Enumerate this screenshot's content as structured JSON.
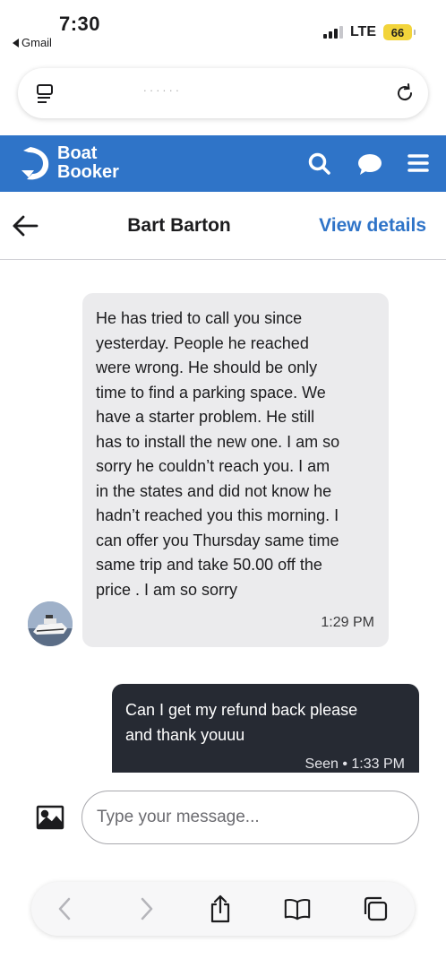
{
  "status_bar": {
    "time": "7:30",
    "back_app": "Gmail",
    "network": "LTE",
    "battery": "66"
  },
  "browser": {
    "url_text": ".  .  .  .  .  .",
    "icons": [
      "tabs-icon",
      "reload-icon"
    ]
  },
  "brand": {
    "line1": "Boat",
    "line2": "Booker",
    "color": "#2f74c8"
  },
  "conversation": {
    "title": "Bart Barton",
    "view_details": "View details"
  },
  "messages": [
    {
      "direction": "incoming",
      "text": "He has tried to call you since\nyesterday.  People he reached\nwere wrong.  He should be only\ntime to find a parking space.  We\nhave a starter problem. He still\nhas to install the new one.  I am so\nsorry he couldn’t reach you.  I am\nin the states and did not know he\nhadn’t reached you this morning.  I\ncan offer you Thursday same time\nsame trip and take 50.00 off the\nprice .  I am so sorry",
      "time": "1:29 PM"
    },
    {
      "direction": "outgoing",
      "text": "Can I get my refund back please\nand thank youuu",
      "status": "Seen • 1:33 PM"
    }
  ],
  "composer": {
    "placeholder": "Type your message..."
  },
  "toolbar": {
    "icons": [
      "back-icon",
      "forward-icon",
      "share-icon",
      "bookmarks-icon",
      "tabs-icon"
    ]
  }
}
